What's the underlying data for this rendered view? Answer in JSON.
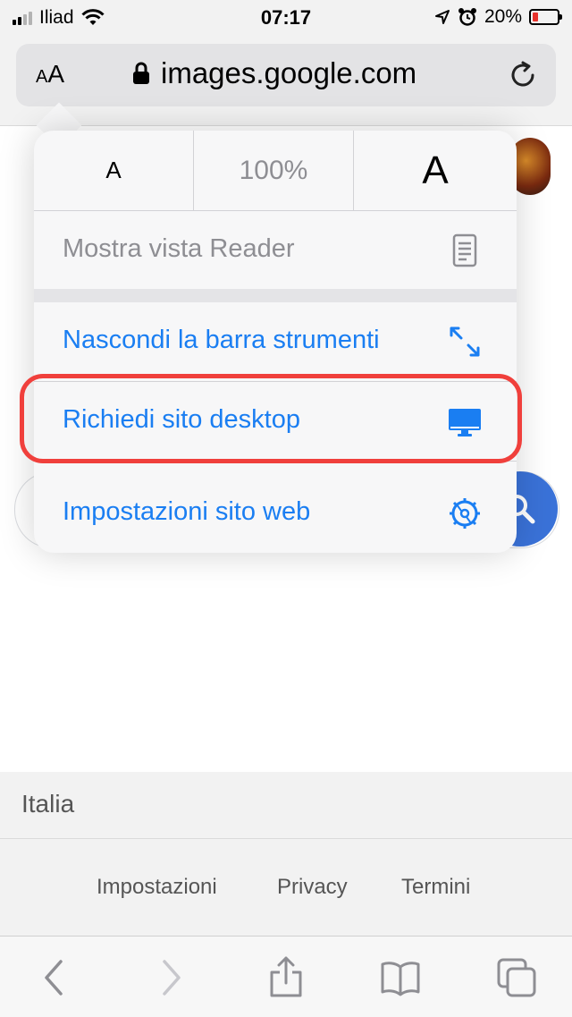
{
  "status_bar": {
    "carrier": "Iliad",
    "time": "07:17",
    "battery": "20%"
  },
  "address_bar": {
    "aa_label": "AA",
    "url": "images.google.com"
  },
  "popover": {
    "font_small": "A",
    "zoom_level": "100%",
    "font_large": "A",
    "items": [
      {
        "label": "Mostra vista Reader",
        "icon": "reader-icon"
      },
      {
        "label": "Nascondi la barra strumenti",
        "icon": "expand-arrows-icon"
      },
      {
        "label": "Richiedi sito desktop",
        "icon": "desktop-monitor-icon"
      },
      {
        "label": "Impostazioni sito web",
        "icon": "gear-icon"
      }
    ]
  },
  "footer": {
    "country": "Italia",
    "links": [
      "Impostazioni",
      "Privacy",
      "Termini"
    ]
  },
  "colors": {
    "accent_blue": "#1a7ef2",
    "highlight_red": "#f0403c",
    "battery_red": "#e8322c",
    "google_search_blue": "#3a72d8"
  }
}
